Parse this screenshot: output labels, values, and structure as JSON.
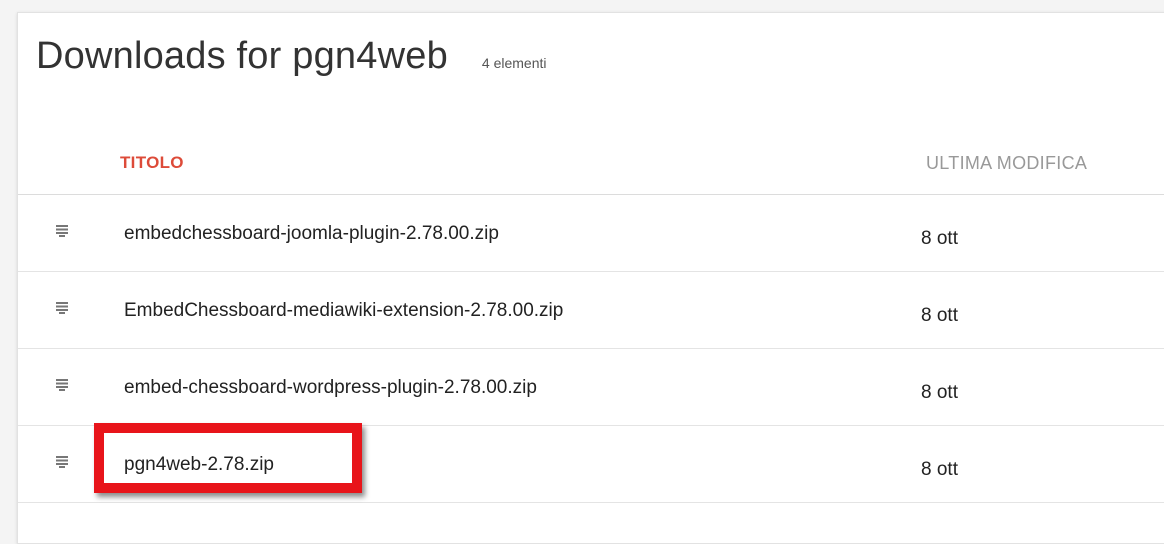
{
  "header": {
    "title": "Downloads for pgn4web",
    "item_count": "4 elementi"
  },
  "table": {
    "columns": {
      "title": "TITOLO",
      "last_modified": "ULTIMA MODIFICA"
    },
    "rows": [
      {
        "name": "embedchessboard-joomla-plugin-2.78.00.zip",
        "date": "8 ott"
      },
      {
        "name": "EmbedChessboard-mediawiki-extension-2.78.00.zip",
        "date": "8 ott"
      },
      {
        "name": "embed-chessboard-wordpress-plugin-2.78.00.zip",
        "date": "8 ott"
      },
      {
        "name": "pgn4web-2.78.zip",
        "date": "8 ott"
      }
    ]
  },
  "annotation": {
    "highlight_color": "#e8141a",
    "highlighted_row": "pgn4web-2.78.zip"
  },
  "colors": {
    "title_header": "#dd4b39",
    "modified_header": "#999999",
    "text": "#222222"
  },
  "icons": {
    "row_icon": "file-lines-icon"
  }
}
